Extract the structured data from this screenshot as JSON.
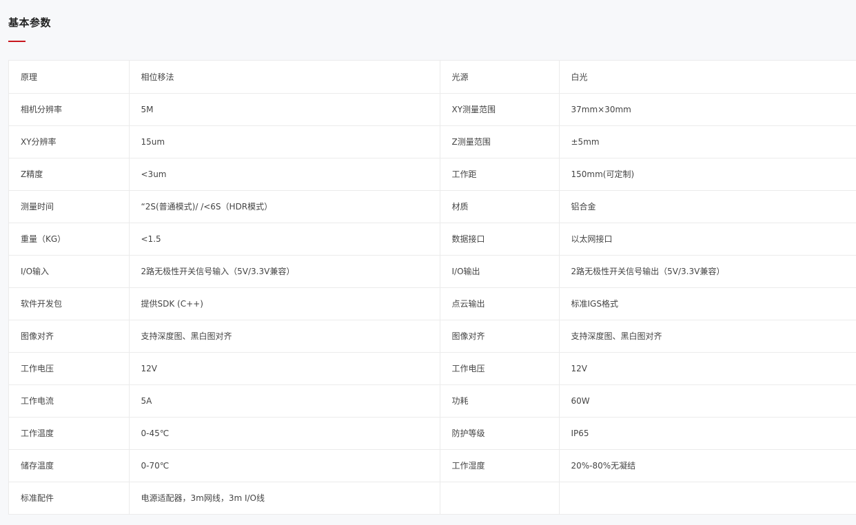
{
  "section": {
    "title": "基本参数",
    "accent_color": "#c8161d"
  },
  "rows": [
    [
      "原理",
      "相位移法",
      "光源",
      "白光"
    ],
    [
      "相机分辨率",
      "5M",
      "XY测量范围",
      "37mm×30mm"
    ],
    [
      "XY分辨率",
      "15um",
      "Z测量范围",
      "±5mm"
    ],
    [
      "Z精度",
      "<3um",
      "工作距",
      "150mm(可定制)"
    ],
    [
      "测量时间",
      "“2S(普通模式)/ /<6S（HDR模式）",
      "材质",
      "铝合金"
    ],
    [
      "重量（KG）",
      "<1.5",
      "数据接口",
      "以太网接口"
    ],
    [
      "I/O输入",
      "2路无极性开关信号输入（5V/3.3V兼容）",
      "I/O输出",
      "2路无极性开关信号输出（5V/3.3V兼容）"
    ],
    [
      "软件开发包",
      "提供SDK (C++)",
      "点云输出",
      "标准IGS格式"
    ],
    [
      "图像对齐",
      "支持深度图、黑白图对齐",
      "图像对齐",
      "支持深度图、黑白图对齐"
    ],
    [
      "工作电压",
      "12V",
      "工作电压",
      "12V"
    ],
    [
      "工作电流",
      "5A",
      "功耗",
      "60W"
    ],
    [
      "工作温度",
      "0-45℃",
      "防护等级",
      "IP65"
    ],
    [
      "储存温度",
      "0-70℃",
      "工作湿度",
      "20%-80%无凝结"
    ],
    [
      "标准配件",
      "电源适配器，3m网线，3m I/O线",
      "",
      ""
    ]
  ]
}
